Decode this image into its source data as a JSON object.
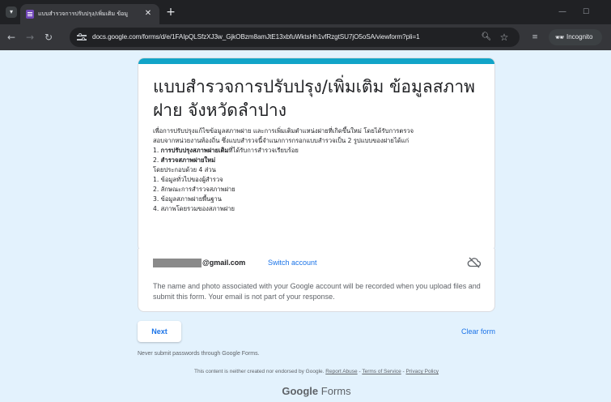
{
  "browser": {
    "tab_title": "แบบสำรวจการปรับปรุง/เพิ่มเติม ข้อมู",
    "url": "docs.google.com/forms/d/e/1FAIpQLSfzXJ3w_GjkOBzm8amJtE13xbfuWktsHh1vfRzgtSU7jO5oSA/viewform?pli=1",
    "incognito_label": "Incognito"
  },
  "form": {
    "accent_color": "#12a4c8",
    "background_color": "#e3f2fd",
    "title": "แบบสำรวจการปรับปรุง/เพิ่มเติม ข้อมูลสภาพฝาย จังหวัดลำปาง",
    "description": {
      "line1": "เพื่อการปรับปรุงแก้ไขข้อมูลสภาพฝาย และการเพิ่มเติมตำแหน่งฝายที่เกิดขึ้นใหม่ โดยได้รับการตรวจ",
      "line2": "สอบจากหน่วยงานท้องถิ่น ซึ่งแบบสำรวจนี้จำแนกการกรอกแบบสำรวจเป็น 2 รูปแบบของฝายได้แก่",
      "item1_prefix": "1. ",
      "item1_bold": "การปรับปรุงสภาพฝายเดิม",
      "item1_rest": "ที่ได้รับการสำรวจเรียบร้อย",
      "item2_prefix": "2. ",
      "item2_bold": "สำรวจสภาพฝายใหม่",
      "sections_intro": "โดยประกอบด้วย 4 ส่วน",
      "sections": [
        "1. ข้อมูลทั่วไปของผู้สำรวจ",
        "2. ลักษณะการสำรวจสภาพฝาย",
        "3. ข้อมูลสภาพฝายพื้นฐาน",
        "4. สภาพโดยรวมของสภาพฝาย"
      ]
    },
    "account": {
      "email_suffix": "@gmail.com",
      "switch_label": "Switch account",
      "note": "The name and photo associated with your Google account will be recorded when you upload files and submit this form. Your email is not part of your response."
    },
    "next_label": "Next",
    "clear_label": "Clear form",
    "never_submit": "Never submit passwords through Google Forms.",
    "disclaimer_text": "This content is neither created nor endorsed by Google.",
    "report_abuse": "Report Abuse",
    "terms": "Terms of Service",
    "privacy": "Privacy Policy",
    "separator": " - ",
    "logo_google": "Google",
    "logo_forms": "Forms"
  }
}
